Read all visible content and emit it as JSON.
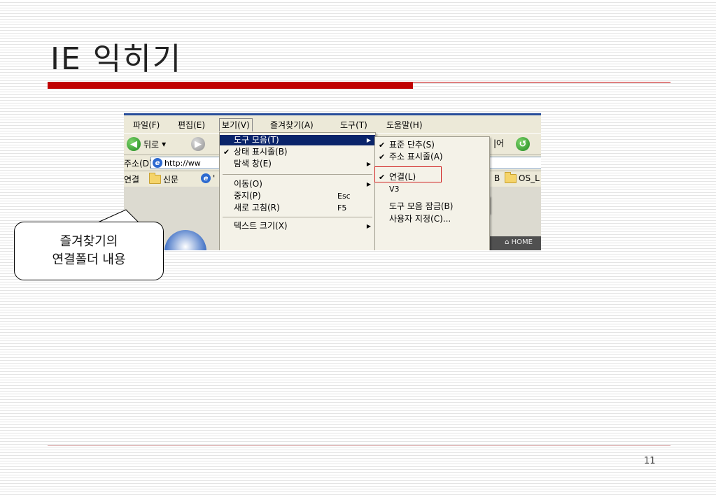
{
  "slide": {
    "title": "IE 익히기",
    "page_number": "11"
  },
  "menubar": {
    "items": [
      "파일(F)",
      "편집(E)",
      "보기(V)",
      "즐겨찾기(A)",
      "도구(T)",
      "도움말(H)"
    ],
    "active_index": 2
  },
  "toolbar": {
    "back_label": "뒤로",
    "back_dropdown": "▾",
    "right_text": "|어"
  },
  "address": {
    "label": "주소(D)",
    "value": "http://ww"
  },
  "links": {
    "label": "연결",
    "items": [
      "신문",
      "'"
    ],
    "right_items": [
      "B",
      "OS_L"
    ]
  },
  "content": {
    "home_label": "HOME"
  },
  "view_menu": {
    "items": [
      {
        "label": "도구 모음(T)",
        "check": "",
        "shortcut": "",
        "arrow": "▶",
        "highlighted": true
      },
      {
        "label": "상태 표시줄(B)",
        "check": "✔",
        "shortcut": "",
        "arrow": "",
        "highlighted": false
      },
      {
        "label": "탐색 창(E)",
        "check": "",
        "shortcut": "",
        "arrow": "▶",
        "highlighted": false
      },
      {
        "label": "이동(O)",
        "check": "",
        "shortcut": "",
        "arrow": "▶",
        "highlighted": false
      },
      {
        "label": "중지(P)",
        "check": "",
        "shortcut": "Esc",
        "arrow": "",
        "highlighted": false
      },
      {
        "label": "새로 고침(R)",
        "check": "",
        "shortcut": "F5",
        "arrow": "",
        "highlighted": false
      },
      {
        "label": "텍스트 크기(X)",
        "check": "",
        "shortcut": "",
        "arrow": "▶",
        "highlighted": false
      }
    ]
  },
  "toolbar_submenu": {
    "items": [
      {
        "label": "표준 단추(S)",
        "check": "✔"
      },
      {
        "label": "주소 표시줄(A)",
        "check": "✔"
      },
      {
        "label": "연결(L)",
        "check": "✔"
      },
      {
        "label": "V3",
        "check": ""
      },
      {
        "label": "도구 모음 잠금(B)",
        "check": ""
      },
      {
        "label": "사용자 지정(C)...",
        "check": ""
      }
    ]
  },
  "callout": {
    "line1": "즐겨찾기의",
    "line2": "연결폴더 내용"
  }
}
